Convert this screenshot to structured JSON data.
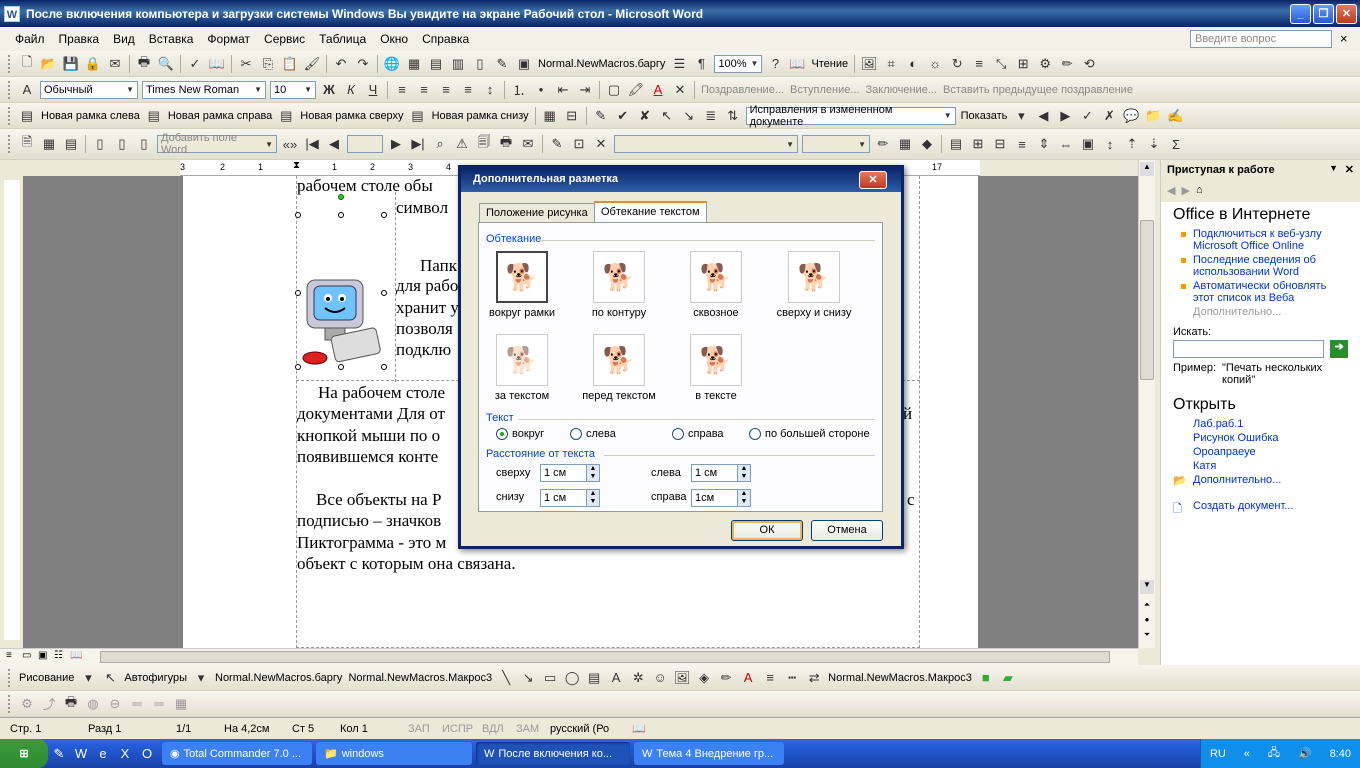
{
  "window": {
    "title": "После включения компьютера и загрузки системы Windows Вы увидите на экране Рабочий стол - Microsoft Word",
    "app_icon": "W"
  },
  "menu": {
    "items": [
      "Файл",
      "Правка",
      "Вид",
      "Вставка",
      "Формат",
      "Сервис",
      "Таблица",
      "Окно",
      "Справка"
    ],
    "help_placeholder": "Введите вопрос",
    "close_glyph": "×"
  },
  "toolbar1": {
    "macro_label": "Normal.NewMacros.баргу",
    "zoom": "100%",
    "read_label": "Чтение"
  },
  "toolbar2": {
    "style": "Обычный",
    "font": "Times New Roman",
    "size": "10",
    "header_footer_items": [
      "Поздравление...",
      "Вступление...",
      "Заключение...",
      "Вставить предыдущее поздравление"
    ]
  },
  "toolbar3": {
    "frame_items": [
      "Новая рамка слева",
      "Новая рамка справа",
      "Новая рамка сверху",
      "Новая рамка снизу"
    ],
    "track_combo": "Исправления в измененном документе",
    "show_label": "Показать"
  },
  "toolbar4": {
    "add_field": "Добавить поле Word"
  },
  "document": {
    "lines": [
      "рабочем столе обы",
      "символ",
      "Папк",
      "для рабо",
      "хранит у",
      "позволя",
      "подклю",
      "На рабочем столе",
      "документами Для от",
      "кнопкой мыши по о",
      "появившемся конте",
      "Все объекты на Р",
      "подписью – значков",
      "Пиктограмма - это м",
      "объект с которым она связана."
    ],
    "right_fragments": [
      "й",
      "с"
    ],
    "ruler_marks": [
      "3",
      "2",
      "1",
      "1",
      "2",
      "3",
      "4",
      "17"
    ]
  },
  "taskpane": {
    "header": "Приступая к работе",
    "office_title": "Office в Интернете",
    "links": [
      "Подключиться к веб-узлу Microsoft Office Online",
      "Последние сведения об использовании Word",
      "Автоматически обновлять этот список из Веба"
    ],
    "more1": "Дополнительно...",
    "search_label": "Искать:",
    "example_label": "Пример:",
    "example_text": "\"Печать нескольких копий\"",
    "open_title": "Открыть",
    "files": [
      "Лаб.раб.1",
      "Рисунок Ошибка",
      "Ороапраеуе",
      "Катя"
    ],
    "more2": "Дополнительно...",
    "create": "Создать документ..."
  },
  "dialog": {
    "title": "Дополнительная разметка",
    "tabs": [
      "Положение рисунка",
      "Обтекание текстом"
    ],
    "wrap_group": "Обтекание",
    "wrap_options": [
      "вокруг рамки",
      "по контуру",
      "сквозное",
      "сверху и снизу",
      "за текстом",
      "перед текстом",
      "в тексте"
    ],
    "text_group": "Текст",
    "text_options": [
      "вокруг",
      "слева",
      "справа",
      "по большей стороне"
    ],
    "distance_group": "Расстояние от текста",
    "distance": {
      "top_label": "сверху",
      "top_value": "1 см",
      "bottom_label": "снизу",
      "bottom_value": "1 см",
      "left_label": "слева",
      "left_value": "1 см",
      "right_label": "справа",
      "right_value": "1см"
    },
    "ok": "ОК",
    "cancel": "Отмена",
    "close_glyph": "✕"
  },
  "drawbar": {
    "draw_label": "Рисование",
    "autoshapes": "Автофигуры",
    "macro1": "Normal.NewMacros.баргу",
    "macro2": "Normal.NewMacros.Макрос3",
    "macro3": "Normal.NewMacros.Макрос3"
  },
  "status": {
    "page": "Стр. 1",
    "section": "Разд 1",
    "pages": "1/1",
    "at": "На 4,2см",
    "line": "Ст 5",
    "col": "Кол 1",
    "rec": "ЗАП",
    "trk": "ИСПР",
    "ext": "ВДЛ",
    "ovr": "ЗАМ",
    "lang": "русский (Ро"
  },
  "taskbar": {
    "apps": [
      "Total Commander 7.0 ...",
      "windows",
      "После включения ко...",
      "Тема 4 Внедрение гр..."
    ],
    "lang": "RU",
    "time": "8:40"
  },
  "colors": {
    "title_blue": "#0a246a",
    "link_blue": "#0033cc",
    "group_blue": "#0046d5",
    "taskbar_blue": "#245edb"
  }
}
